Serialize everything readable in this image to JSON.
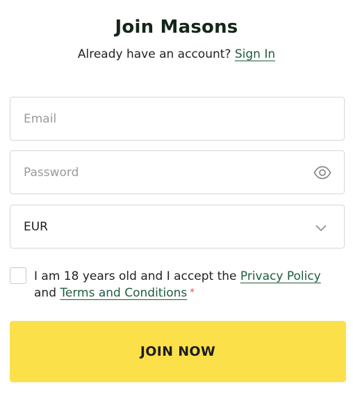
{
  "header": {
    "title": "Join Masons",
    "signin_prompt": "Already have an account?",
    "signin_link": "Sign In"
  },
  "form": {
    "email": {
      "placeholder": "Email",
      "value": ""
    },
    "password": {
      "placeholder": "Password",
      "value": "",
      "icon": "eye-icon"
    },
    "currency": {
      "selected": "EUR",
      "icon": "chevron-down-icon"
    },
    "terms": {
      "text_before": "I am 18 years old and I accept the",
      "privacy_link": "Privacy Policy",
      "and_text": "and",
      "terms_link": "Terms and Conditions",
      "required_mark": "*",
      "checked": false
    },
    "submit_label": "JOIN NOW"
  },
  "colors": {
    "button_bg": "#fce04a",
    "link": "#1e5c3f",
    "title": "#14261a",
    "required": "#e04545"
  }
}
